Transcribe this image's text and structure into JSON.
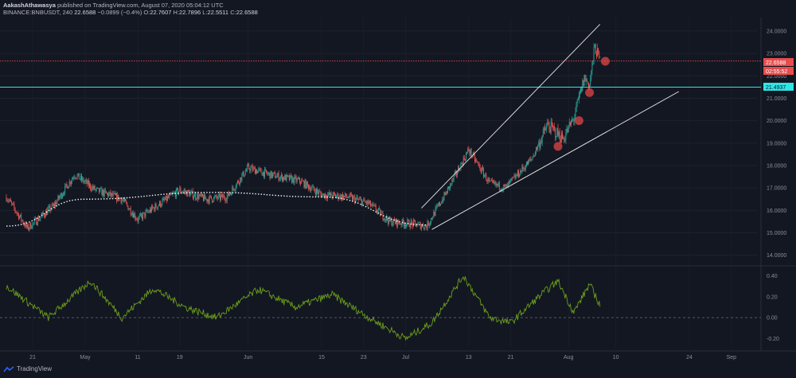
{
  "header": {
    "publisher": "AakashAthawasya",
    "publish_text": "published on TradingView.com, August 07, 2020 05:04:12 UTC",
    "symbol": "BINANCE:BNBUSDT, 240",
    "last": "22.6588",
    "change": "−0.0899 (−0.4%)",
    "o_label": "O:",
    "o": "22.7607",
    "h_label": "H:",
    "h": "22.7896",
    "l_label": "L:",
    "l": "22.5511",
    "c_label": "C:",
    "c": "22.6588"
  },
  "price_badges": {
    "current": "22.6588",
    "countdown": "02:55:52",
    "cyan_level": "21.4937"
  },
  "footer": {
    "brand": "TradingView"
  },
  "colors": {
    "background": "#131722",
    "up": "#26a69a",
    "down": "#ef5350",
    "oscillator": "#6b9e1a",
    "cyan_line": "#2ee6e6",
    "red_line": "#e84c4c"
  },
  "chart_data": [
    {
      "type": "candlestick",
      "x_labels": [
        "21",
        "May",
        "11",
        "19",
        "Jun",
        "15",
        "23",
        "Jul",
        "13",
        "21",
        "Aug",
        "10",
        "24",
        "Sep",
        "14"
      ],
      "y_ticks": [
        "24.0000",
        "23.0000",
        "22.0000",
        "21.0000",
        "20.0000",
        "19.0000",
        "18.0000",
        "17.0000",
        "16.0000",
        "15.0000",
        "14.0000"
      ],
      "ylim": [
        13.6,
        24.6
      ],
      "anchors": [
        {
          "date": "2020-04-16",
          "close": 16.6
        },
        {
          "date": "2020-04-20",
          "close": 15.2
        },
        {
          "date": "2020-04-25",
          "close": 16.2
        },
        {
          "date": "2020-04-29",
          "close": 17.6
        },
        {
          "date": "2020-05-03",
          "close": 16.9
        },
        {
          "date": "2020-05-08",
          "close": 16.5
        },
        {
          "date": "2020-05-11",
          "close": 15.6
        },
        {
          "date": "2020-05-14",
          "close": 16.1
        },
        {
          "date": "2020-05-19",
          "close": 16.9
        },
        {
          "date": "2020-05-24",
          "close": 16.5
        },
        {
          "date": "2020-05-28",
          "close": 16.6
        },
        {
          "date": "2020-06-01",
          "close": 17.9
        },
        {
          "date": "2020-06-05",
          "close": 17.6
        },
        {
          "date": "2020-06-11",
          "close": 17.3
        },
        {
          "date": "2020-06-15",
          "close": 16.7
        },
        {
          "date": "2020-06-20",
          "close": 16.6
        },
        {
          "date": "2020-06-24",
          "close": 16.3
        },
        {
          "date": "2020-06-28",
          "close": 15.5
        },
        {
          "date": "2020-07-02",
          "close": 15.4
        },
        {
          "date": "2020-07-05",
          "close": 15.3
        },
        {
          "date": "2020-07-09",
          "close": 16.9
        },
        {
          "date": "2020-07-13",
          "close": 18.7
        },
        {
          "date": "2020-07-17",
          "close": 17.2
        },
        {
          "date": "2020-07-20",
          "close": 17.0
        },
        {
          "date": "2020-07-25",
          "close": 18.3
        },
        {
          "date": "2020-07-28",
          "close": 19.8
        },
        {
          "date": "2020-07-31",
          "close": 19.2
        },
        {
          "date": "2020-08-02",
          "close": 20.1
        },
        {
          "date": "2020-08-04",
          "close": 21.9
        },
        {
          "date": "2020-08-05",
          "close": 21.6
        },
        {
          "date": "2020-08-06",
          "close": 23.3
        },
        {
          "date": "2020-08-07",
          "close": 22.66
        }
      ],
      "last_date": "2020-08-07",
      "current_price": 22.6588,
      "cyan_level": 21.4937,
      "channel_upper": [
        {
          "date": "2020-07-04",
          "price": 16.1
        },
        {
          "date": "2020-08-07",
          "price": 24.3
        }
      ],
      "channel_lower": [
        {
          "date": "2020-07-06",
          "price": 15.15
        },
        {
          "date": "2020-08-22",
          "price": 21.3
        }
      ],
      "arc": [
        {
          "date": "2020-04-16",
          "price": 15.3
        },
        {
          "date": "2020-05-01",
          "price": 16.5
        },
        {
          "date": "2020-05-25",
          "price": 16.8
        },
        {
          "date": "2020-06-15",
          "price": 16.6
        },
        {
          "date": "2020-07-05",
          "price": 15.35
        }
      ],
      "markers": [
        {
          "date": "2020-07-30",
          "price": 18.85
        },
        {
          "date": "2020-08-03",
          "price": 20.0
        },
        {
          "date": "2020-08-05",
          "price": 21.25
        },
        {
          "date": "2020-08-08",
          "price": 22.65
        }
      ]
    },
    {
      "type": "line",
      "series": [
        {
          "values_anchors": [
            {
              "date": "2020-04-16",
              "value": 0.3
            },
            {
              "date": "2020-04-24",
              "value": 0.0
            },
            {
              "date": "2020-05-02",
              "value": 0.35
            },
            {
              "date": "2020-05-08",
              "value": 0.0
            },
            {
              "date": "2020-05-14",
              "value": 0.28
            },
            {
              "date": "2020-05-20",
              "value": 0.1
            },
            {
              "date": "2020-05-26",
              "value": 0.0
            },
            {
              "date": "2020-06-03",
              "value": 0.27
            },
            {
              "date": "2020-06-10",
              "value": 0.1
            },
            {
              "date": "2020-06-17",
              "value": 0.22
            },
            {
              "date": "2020-06-24",
              "value": 0.0
            },
            {
              "date": "2020-07-01",
              "value": -0.2
            },
            {
              "date": "2020-07-06",
              "value": -0.05
            },
            {
              "date": "2020-07-12",
              "value": 0.4
            },
            {
              "date": "2020-07-17",
              "value": 0.0
            },
            {
              "date": "2020-07-21",
              "value": -0.05
            },
            {
              "date": "2020-07-27",
              "value": 0.23
            },
            {
              "date": "2020-07-30",
              "value": 0.35
            },
            {
              "date": "2020-08-02",
              "value": 0.05
            },
            {
              "date": "2020-08-05",
              "value": 0.32
            },
            {
              "date": "2020-08-07",
              "value": 0.12
            }
          ]
        }
      ],
      "y_ticks": [
        "0.40",
        "0.20",
        "0.00",
        "-0.20"
      ],
      "ylim": [
        -0.28,
        0.48
      ]
    }
  ]
}
